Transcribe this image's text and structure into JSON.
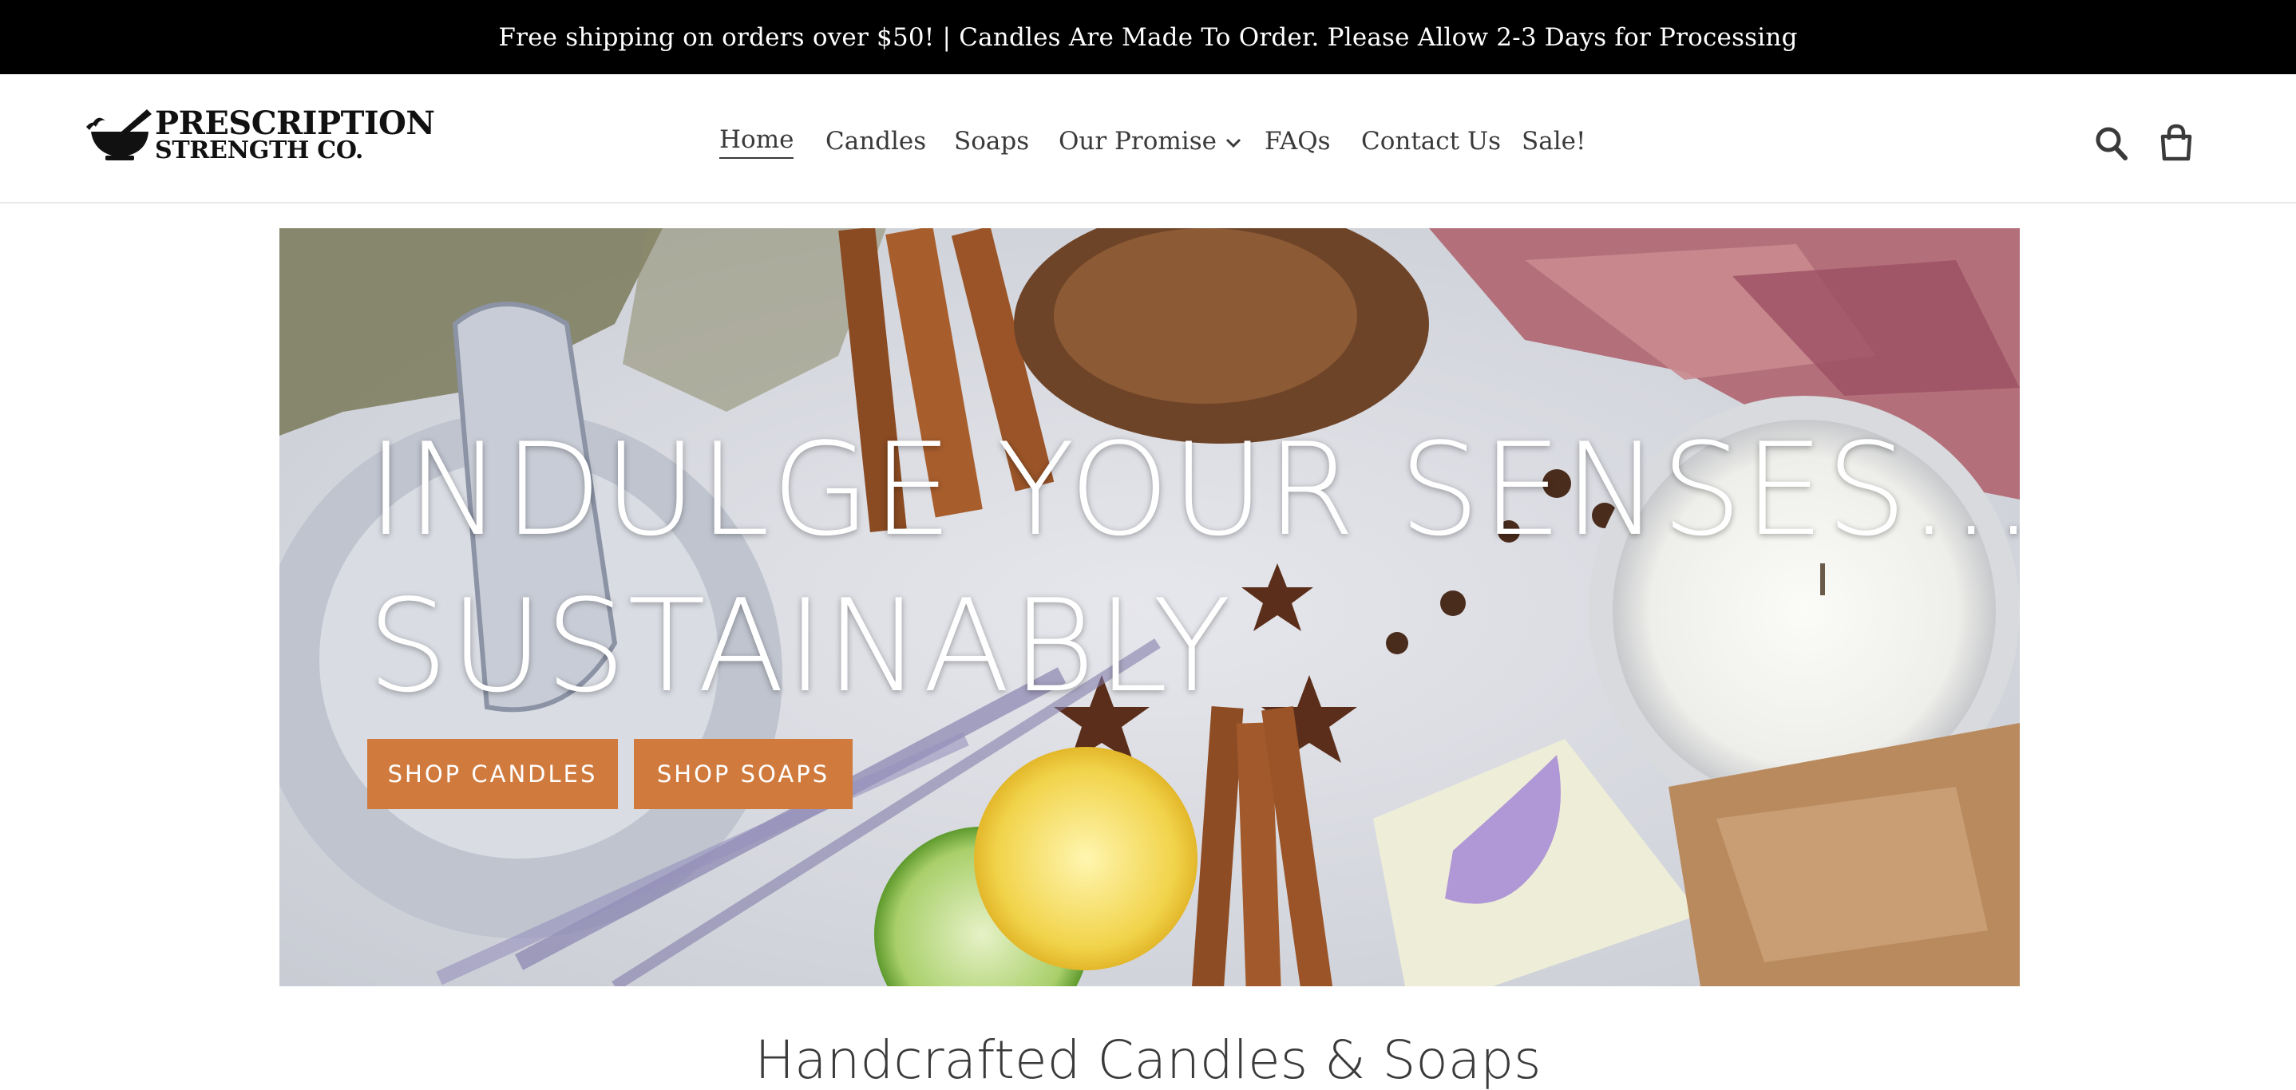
{
  "announcement": {
    "text": "Free shipping on orders over $50! | Candles Are Made To Order. Please Allow 2-3 Days for Processing"
  },
  "header": {
    "logo": {
      "line1": "PRESCRIPTION",
      "line2": "STRENGTH CO.",
      "icon": "mortar-and-pestle-icon"
    },
    "nav": [
      {
        "label": "Home",
        "active": true
      },
      {
        "label": "Candles",
        "active": false
      },
      {
        "label": "Soaps",
        "active": false
      },
      {
        "label": "Our Promise",
        "active": false,
        "has_dropdown": true
      },
      {
        "label": "FAQs",
        "active": false
      },
      {
        "label": "Contact Us",
        "active": false
      },
      {
        "label": "Sale!",
        "active": false
      }
    ],
    "icons": {
      "search": "search-icon",
      "cart": "cart-icon"
    }
  },
  "hero": {
    "title_line1": "INDULGE YOUR SENSES...",
    "title_line2": "SUSTAINABLY",
    "buttons": [
      {
        "label": "SHOP CANDLES"
      },
      {
        "label": "SHOP SOAPS"
      }
    ]
  },
  "section": {
    "title": "Handcrafted Candles & Soaps"
  },
  "colors": {
    "announcement_bg": "#000000",
    "button_accent": "#d07a3d",
    "text": "#3a3a3a"
  }
}
